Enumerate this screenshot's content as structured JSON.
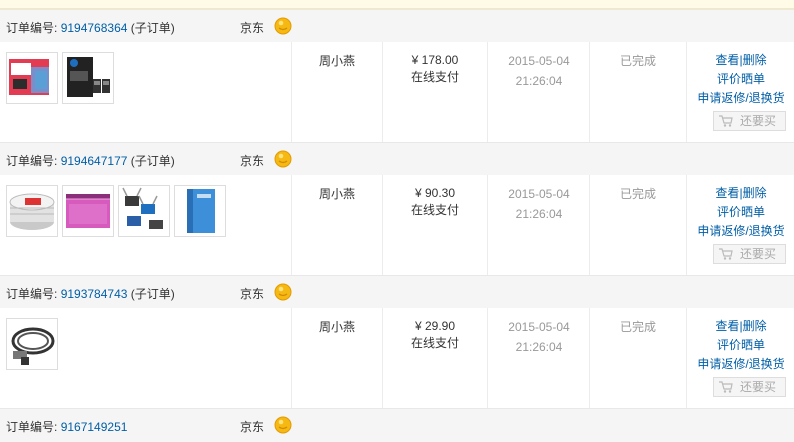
{
  "labels": {
    "order_no_prefix": "订单编号:",
    "shop": "京东",
    "status": "已完成",
    "op_view": "查看",
    "op_sep": "|",
    "op_delete": "删除",
    "op_review": "评价晒单",
    "op_return": "申请返修/退换货",
    "rebuy": "还要买"
  },
  "orders": [
    {
      "number": "9194768364",
      "sub": " (子订单)",
      "recipient": "周小燕",
      "amount": "¥ 178.00",
      "payment": "在线支付",
      "date": "2015-05-04",
      "time": "21:26:04",
      "items": [
        "ink-cartridge-box",
        "hp-ink-cartridge"
      ]
    },
    {
      "number": "9194647177",
      "sub": " (子订单)",
      "recipient": "周小燕",
      "amount": "¥ 90.30",
      "payment": "在线支付",
      "date": "2015-05-04",
      "time": "21:26:04",
      "items": [
        "cd-spindle",
        "pink-zipper-bag",
        "binder-clips",
        "blue-folder"
      ]
    },
    {
      "number": "9193784743",
      "sub": " (子订单)",
      "recipient": "周小燕",
      "amount": "¥ 29.90",
      "payment": "在线支付",
      "date": "2015-05-04",
      "time": "21:26:04",
      "items": [
        "usb-cable"
      ]
    },
    {
      "number": "9167149251",
      "sub": ""
    }
  ],
  "colors": {
    "link": "#005ea7",
    "muted": "#999999",
    "header_bg": "#f5f5f5",
    "smiley": "#f6b813"
  }
}
